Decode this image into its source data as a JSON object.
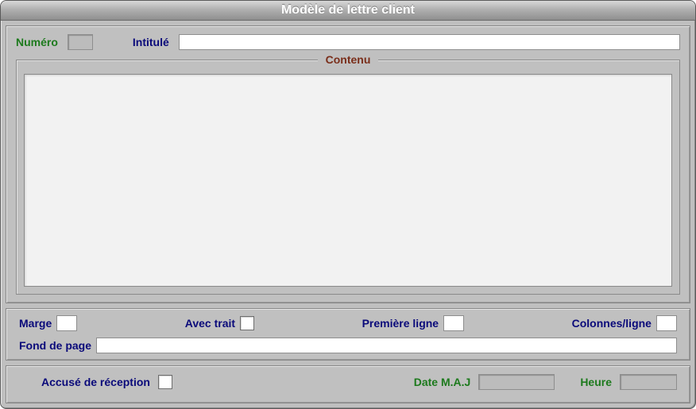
{
  "window": {
    "title": "Modèle de lettre client"
  },
  "header": {
    "numero_label": "Numéro",
    "numero_value": "",
    "intitule_label": "Intitulé",
    "intitule_value": ""
  },
  "contenu": {
    "legend": "Contenu",
    "text": ""
  },
  "format": {
    "marge_label": "Marge",
    "marge_value": "",
    "trait_label": "Avec trait",
    "trait_checked": false,
    "premiere_label": "Première ligne",
    "premiere_value": "",
    "colonnes_label": "Colonnes/ligne",
    "colonnes_value": "",
    "fond_label": "Fond de page",
    "fond_value": ""
  },
  "footer": {
    "accuse_label": "Accusé de réception",
    "accuse_checked": false,
    "date_label": "Date M.A.J",
    "date_value": "",
    "heure_label": "Heure",
    "heure_value": ""
  }
}
